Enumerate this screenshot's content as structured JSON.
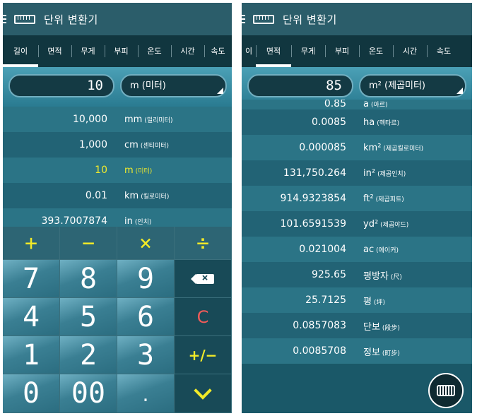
{
  "left_screen": {
    "app_title": "단위 변환기",
    "tabs": [
      {
        "label": "길이",
        "active": true
      },
      {
        "label": "면적",
        "active": false
      },
      {
        "label": "무게",
        "active": false
      },
      {
        "label": "부피",
        "active": false
      },
      {
        "label": "온도",
        "active": false
      },
      {
        "label": "시간",
        "active": false
      },
      {
        "label": "속도",
        "active": false
      }
    ],
    "input_value": "10",
    "selected_unit": "m (미터)",
    "results": [
      {
        "value": "10,000",
        "unit": "mm",
        "unit_name": "(밀리미터)",
        "highlight": false
      },
      {
        "value": "1,000",
        "unit": "cm",
        "unit_name": "(센티미터)",
        "highlight": false
      },
      {
        "value": "10",
        "unit": "m",
        "unit_name": "(미터)",
        "highlight": true
      },
      {
        "value": "0.01",
        "unit": "km",
        "unit_name": "(킬로미터)",
        "highlight": false
      },
      {
        "value": "393.7007874",
        "unit": "in",
        "unit_name": "(인치)",
        "highlight": false
      }
    ],
    "keypad": {
      "plus": "+",
      "minus": "−",
      "multiply": "×",
      "divide": "÷",
      "digits": [
        "7",
        "8",
        "9",
        "4",
        "5",
        "6",
        "1",
        "2",
        "3",
        "0",
        "00",
        "."
      ],
      "clear": "C",
      "plus_minus": "+/−"
    }
  },
  "right_screen": {
    "app_title": "단위 변환기",
    "tabs": [
      {
        "label": "이",
        "active": false
      },
      {
        "label": "면적",
        "active": true
      },
      {
        "label": "무게",
        "active": false
      },
      {
        "label": "부피",
        "active": false
      },
      {
        "label": "온도",
        "active": false
      },
      {
        "label": "시간",
        "active": false
      },
      {
        "label": "속도",
        "active": false
      }
    ],
    "input_value": "85",
    "selected_unit": "m² (제곱미터)",
    "results": [
      {
        "value": "0.85",
        "unit": "a",
        "unit_name": "(아르)",
        "partial": true
      },
      {
        "value": "0.0085",
        "unit": "ha",
        "unit_name": "(헥타르)"
      },
      {
        "value": "0.000085",
        "unit": "km²",
        "unit_name": "(제곱킬로미터)"
      },
      {
        "value": "131,750.264",
        "unit": "in²",
        "unit_name": "(제곱인치)"
      },
      {
        "value": "914.9323854",
        "unit": "ft²",
        "unit_name": "(제곱피트)"
      },
      {
        "value": "101.6591539",
        "unit": "yd²",
        "unit_name": "(제곱야드)"
      },
      {
        "value": "0.021004",
        "unit": "ac",
        "unit_name": "(에이커)"
      },
      {
        "value": "925.65",
        "unit": "평방자",
        "unit_name": "(尺)"
      },
      {
        "value": "25.7125",
        "unit": "평",
        "unit_name": "(坪)"
      },
      {
        "value": "0.0857083",
        "unit": "단보",
        "unit_name": "(段步)"
      },
      {
        "value": "0.0085708",
        "unit": "정보",
        "unit_name": "(町步)"
      }
    ]
  },
  "colors": {
    "appbar": "#2b5d6a",
    "tabbar": "#11363f",
    "highlight": "#f0ea2c",
    "operator": "#f2ea28",
    "clear": "#ef5b59"
  },
  "icons": [
    "menu-icon",
    "ruler-icon",
    "backspace-icon",
    "chevron-down-icon",
    "keyboard-icon"
  ]
}
